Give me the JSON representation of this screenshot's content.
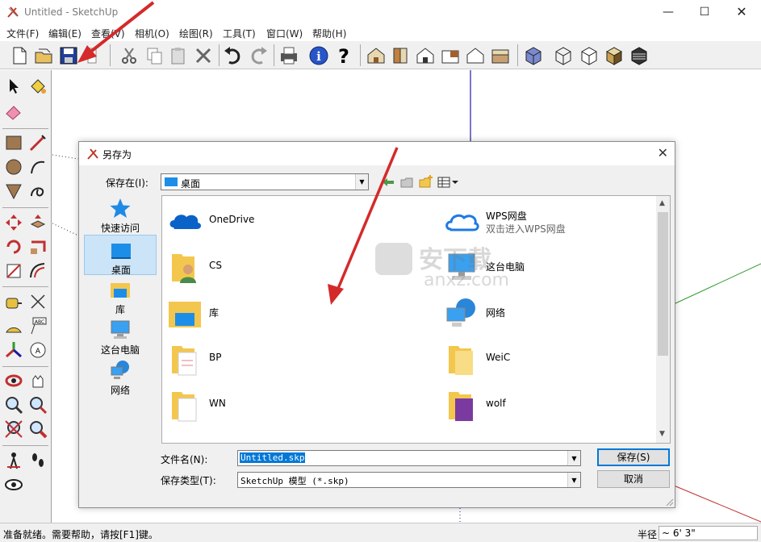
{
  "window": {
    "title": "Untitled - SketchUp"
  },
  "menu": [
    "文件(F)",
    "编辑(E)",
    "查看(V)",
    "相机(O)",
    "绘图(R)",
    "工具(T)",
    "窗口(W)",
    "帮助(H)"
  ],
  "dialog": {
    "title": "另存为",
    "save_in_label": "保存在(I):",
    "save_in_value": "桌面",
    "places": [
      "快速访问",
      "桌面",
      "库",
      "这台电脑",
      "网络"
    ],
    "files": [
      {
        "name": "OneDrive",
        "sub": "",
        "icon": "onedrive-icon"
      },
      {
        "name": "WPS网盘",
        "sub": "双击进入WPS网盘",
        "icon": "wps-cloud-icon"
      },
      {
        "name": "CS",
        "sub": "",
        "icon": "user-folder-icon"
      },
      {
        "name": "这台电脑",
        "sub": "",
        "icon": "computer-icon"
      },
      {
        "name": "库",
        "sub": "",
        "icon": "library-icon"
      },
      {
        "name": "网络",
        "sub": "",
        "icon": "network-icon"
      },
      {
        "name": "BP",
        "sub": "",
        "icon": "folder-icon"
      },
      {
        "name": "WeiC",
        "sub": "",
        "icon": "folder-icon"
      },
      {
        "name": "WN",
        "sub": "",
        "icon": "folder-icon"
      },
      {
        "name": "wolf",
        "sub": "",
        "icon": "folder-icon"
      }
    ],
    "filename_label": "文件名(N):",
    "filename_value": "Untitled.skp",
    "filetype_label": "保存类型(T):",
    "filetype_value": "SketchUp 模型 (*.skp)",
    "save_button": "保存(S)",
    "cancel_button": "取消"
  },
  "status": {
    "message": "准备就绪。需要帮助，请按[F1]键。",
    "radius_label": "半径",
    "radius_value": "~ 6' 3\""
  },
  "watermark": {
    "text": "安下载",
    "url": "anxz.com"
  },
  "colors": {
    "highlight": "#0078d7",
    "arrow_red": "#d42a2a",
    "axis_blue": "#1a1aa0",
    "axis_green": "#2e9a2e",
    "axis_red": "#c03030"
  }
}
